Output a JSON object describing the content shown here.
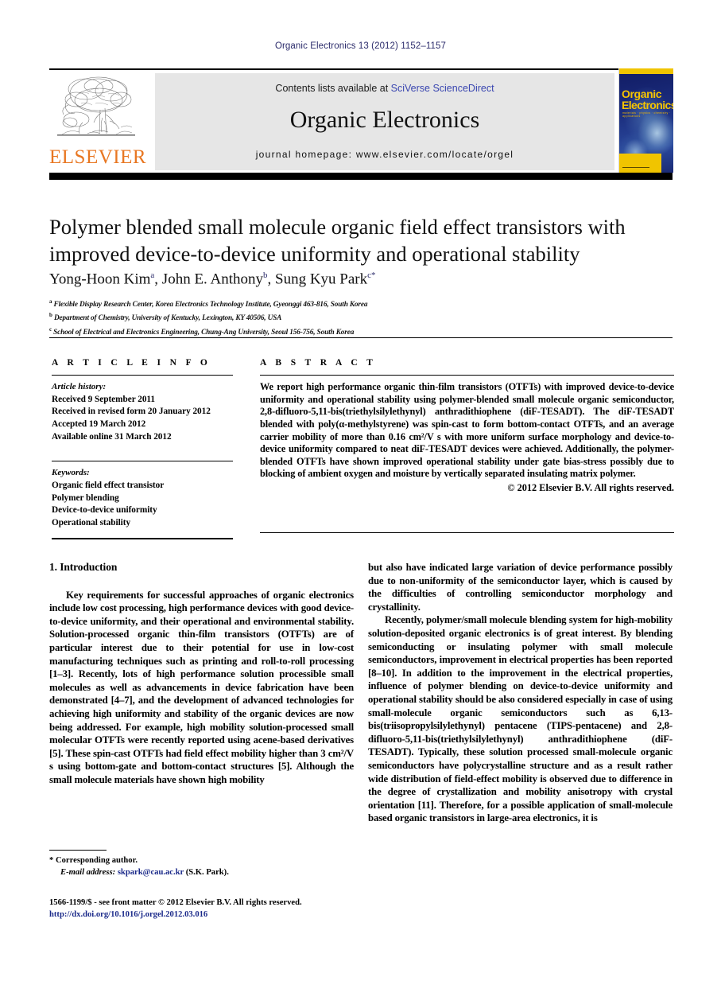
{
  "running_head": "Organic Electronics 13 (2012) 1152–1157",
  "masthead": {
    "contents_prefix": "Contents lists available at ",
    "sciencedirect": "SciVerse ScienceDirect",
    "journal_title": "Organic Electronics",
    "homepage": "journal homepage: www.elsevier.com/locate/orgel",
    "publisher": "ELSEVIER",
    "cover": {
      "line1": "Organic",
      "line2": "Electronics",
      "subtitle": "materials · physics · chemistry · applications"
    },
    "link_color": "#3a46b0",
    "band_color": "#e6e6e6",
    "elsevier_orange": "#e87722"
  },
  "article": {
    "title": "Polymer blended small molecule organic field effect transistors with improved device-to-device uniformity and operational stability",
    "authors": [
      {
        "name": "Yong-Hoon Kim",
        "mark": "a"
      },
      {
        "name": "John E. Anthony",
        "mark": "b"
      },
      {
        "name": "Sung Kyu Park",
        "mark": "c",
        "corresponding": "*"
      }
    ],
    "affiliations": [
      {
        "mark": "a",
        "text": "Flexible Display Research Center, Korea Electronics Technology Institute, Gyeonggi 463-816, South Korea"
      },
      {
        "mark": "b",
        "text": "Department of Chemistry, University of Kentucky, Lexington, KY 40506, USA"
      },
      {
        "mark": "c",
        "text": "School of Electrical and Electronics Engineering, Chung-Ang University, Seoul 156-756, South Korea"
      }
    ]
  },
  "article_info": {
    "heading": "A R T I C L E  I N F O",
    "history_label": "Article history:",
    "history": [
      "Received 9 September 2011",
      "Received in revised form 20 January 2012",
      "Accepted 19 March 2012",
      "Available online 31 March 2012"
    ],
    "keywords_label": "Keywords:",
    "keywords": [
      "Organic field effect transistor",
      "Polymer blending",
      "Device-to-device uniformity",
      "Operational stability"
    ]
  },
  "abstract": {
    "heading": "A B S T R A C T",
    "text": "We report high performance organic thin-film transistors (OTFTs) with improved device-to-device uniformity and operational stability using polymer-blended small molecule organic semiconductor, 2,8-difluoro-5,11-bis(triethylsilylethynyl) anthradithiophene (diF-TESADT). The diF-TESADT blended with poly(α-methylstyrene) was spin-cast to form bottom-contact OTFTs, and an average carrier mobility of more than 0.16 cm²/V s with more uniform surface morphology and device-to-device uniformity compared to neat diF-TESADT devices were achieved. Additionally, the polymer-blended OTFTs have shown improved operational stability under gate bias-stress possibly due to blocking of ambient oxygen and moisture by vertically separated insulating matrix polymer.",
    "copyright": "© 2012 Elsevier B.V. All rights reserved."
  },
  "body": {
    "section_heading": "1. Introduction",
    "left_paragraphs": [
      "Key requirements for successful approaches of organic electronics include low cost processing, high performance devices with good device-to-device uniformity, and their operational and environmental stability. Solution-processed organic thin-film transistors (OTFTs) are of particular interest due to their potential for use in low-cost manufacturing techniques such as printing and roll-to-roll processing [1–3]. Recently, lots of high performance solution processible small molecules as well as advancements in device fabrication have been demonstrated [4–7], and the development of advanced technologies for achieving high uniformity and stability of the organic devices are now being addressed. For example, high mobility solution-processed small molecular OTFTs were recently reported using acene-based derivatives [5]. These spin-cast OTFTs had field effect mobility higher than 3 cm²/V s using bottom-gate and bottom-contact structures [5]. Although the small molecule materials have shown high mobility"
    ],
    "right_paragraphs": [
      "but also have indicated large variation of device performance possibly due to non-uniformity of the semiconductor layer, which is caused by the difficulties of controlling semiconductor morphology and crystallinity.",
      "Recently, polymer/small molecule blending system for high-mobility solution-deposited organic electronics is of great interest. By blending semiconducting or insulating polymer with small molecule semiconductors, improvement in electrical properties has been reported [8–10]. In addition to the improvement in the electrical properties, influence of polymer blending on device-to-device uniformity and operational stability should be also considered especially in case of using small-molecule organic semiconductors such as 6,13-bis(triisopropylsilylethynyl) pentacene (TIPS-pentacene) and 2,8-difluoro-5,11-bis(triethylsilylethynyl) anthradithiophene (diF-TESADT). Typically, these solution processed small-molecule organic semiconductors have polycrystalline structure and as a result rather wide distribution of field-effect mobility is observed due to difference in the degree of crystallization and mobility anisotropy with crystal orientation [11]. Therefore, for a possible application of small-molecule based organic transistors in large-area electronics, it is"
    ]
  },
  "footnote": {
    "corresponding_marker": "*",
    "corresponding_text": "Corresponding author.",
    "email_label": "E-mail address:",
    "email": "skpark@cau.ac.kr",
    "email_owner": "(S.K. Park)."
  },
  "footer": {
    "issn_line": "1566-1199/$ - see front matter © 2012 Elsevier B.V. All rights reserved.",
    "doi": "http://dx.doi.org/10.1016/j.orgel.2012.03.016",
    "link_color": "#1b2a8a"
  }
}
